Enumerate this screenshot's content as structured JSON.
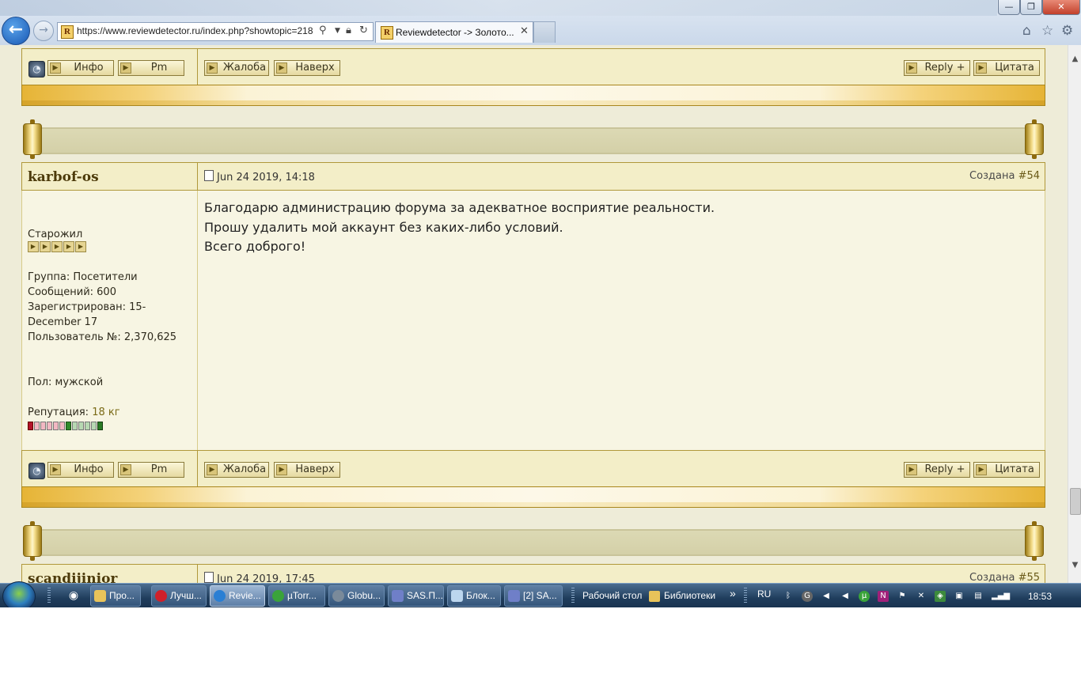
{
  "browser": {
    "url": "https://www.reviewdetector.ru/index.php?showtopic=218",
    "tab_title": "Reviewdetector -> Золото...",
    "win_minimize": "—",
    "win_maximize": "❐",
    "win_close": "✕"
  },
  "post_buttons": {
    "info": "Инфо",
    "pm": "Pm",
    "complaint": "Жалоба",
    "top": "Наверх",
    "reply": "Reply +",
    "quote": "Цитата"
  },
  "post54": {
    "author": "karbof-os",
    "date": "Jun 24 2019, 14:18",
    "created_prefix": "Создана",
    "post_number": "#54",
    "rank": "Старожил",
    "group": "Группа: Посетители",
    "messages": "Сообщений: 600",
    "registered": "Зарегистрирован: 15-December 17",
    "user_no": "Пользователь №: 2,370,625",
    "gender": "Пол: мужской",
    "reputation_label": "Репутация:",
    "reputation_value": "18 кг",
    "message_lines": [
      "Благодарю администрацию форума за адекватное восприятие реальности.",
      "Прошу удалить мой аккаунт без каких-либо условий.",
      "Всего доброго!"
    ]
  },
  "post55": {
    "author": "scandijinior",
    "date": "Jun 24 2019, 17:45",
    "created_prefix": "Создана",
    "post_number": "#55"
  },
  "taskbar": {
    "items": [
      "Про...",
      "Лучш...",
      "Revie...",
      "µTorr...",
      "Globu...",
      "SAS.П...",
      "Блок...",
      "[2] SA..."
    ],
    "desktop": "Рабочий стол",
    "libraries": "Библиотеки",
    "chevron": "»",
    "lang": "RU",
    "time": "18:53"
  },
  "colors": {
    "page_bg": "#eeecd8",
    "bar_bg": "#f3eec8",
    "gold": "#e6b436",
    "author": "#4d3b0b"
  }
}
